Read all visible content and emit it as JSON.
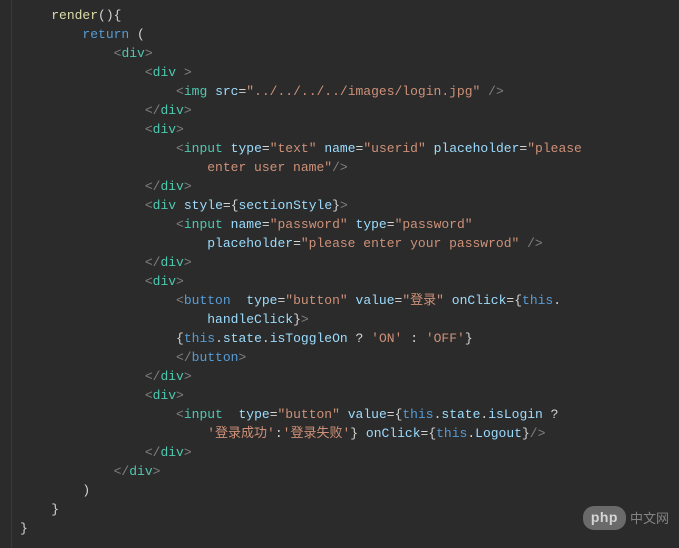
{
  "code": {
    "lines": [
      {
        "indent": 1,
        "segs": [
          {
            "cls": "fn",
            "t": "render"
          },
          {
            "cls": "punct",
            "t": "(){"
          }
        ]
      },
      {
        "indent": 2,
        "segs": [
          {
            "cls": "kw",
            "t": "return"
          },
          {
            "cls": "plain",
            "t": " ("
          }
        ]
      },
      {
        "indent": 3,
        "segs": [
          {
            "cls": "tag",
            "t": "<"
          },
          {
            "cls": "tagname",
            "t": "div"
          },
          {
            "cls": "tag",
            "t": ">"
          }
        ]
      },
      {
        "indent": 4,
        "segs": [
          {
            "cls": "tag",
            "t": "<"
          },
          {
            "cls": "tagname",
            "t": "div"
          },
          {
            "cls": "plain",
            "t": " "
          },
          {
            "cls": "tag",
            "t": ">"
          }
        ]
      },
      {
        "indent": 5,
        "segs": [
          {
            "cls": "tag",
            "t": "<"
          },
          {
            "cls": "tagname",
            "t": "img"
          },
          {
            "cls": "plain",
            "t": " "
          },
          {
            "cls": "attr",
            "t": "src"
          },
          {
            "cls": "eq",
            "t": "="
          },
          {
            "cls": "str",
            "t": "\"../../../../images/login.jpg\""
          },
          {
            "cls": "plain",
            "t": " "
          },
          {
            "cls": "tag",
            "t": "/>"
          }
        ]
      },
      {
        "indent": 4,
        "segs": [
          {
            "cls": "tag",
            "t": "</"
          },
          {
            "cls": "tagname",
            "t": "div"
          },
          {
            "cls": "tag",
            "t": ">"
          }
        ]
      },
      {
        "indent": 4,
        "segs": [
          {
            "cls": "tag",
            "t": "<"
          },
          {
            "cls": "tagname",
            "t": "div"
          },
          {
            "cls": "tag",
            "t": ">"
          }
        ]
      },
      {
        "indent": 5,
        "segs": [
          {
            "cls": "tag",
            "t": "<"
          },
          {
            "cls": "tagname",
            "t": "input"
          },
          {
            "cls": "plain",
            "t": " "
          },
          {
            "cls": "attr",
            "t": "type"
          },
          {
            "cls": "eq",
            "t": "="
          },
          {
            "cls": "str",
            "t": "\"text\""
          },
          {
            "cls": "plain",
            "t": " "
          },
          {
            "cls": "attr",
            "t": "name"
          },
          {
            "cls": "eq",
            "t": "="
          },
          {
            "cls": "str",
            "t": "\"userid\""
          },
          {
            "cls": "plain",
            "t": " "
          },
          {
            "cls": "attr",
            "t": "placeholder"
          },
          {
            "cls": "eq",
            "t": "="
          },
          {
            "cls": "str",
            "t": "\"please "
          }
        ]
      },
      {
        "indent": 6,
        "segs": [
          {
            "cls": "str",
            "t": "enter user name\""
          },
          {
            "cls": "tag",
            "t": "/>"
          }
        ]
      },
      {
        "indent": 4,
        "segs": [
          {
            "cls": "tag",
            "t": "</"
          },
          {
            "cls": "tagname",
            "t": "div"
          },
          {
            "cls": "tag",
            "t": ">"
          }
        ]
      },
      {
        "indent": 4,
        "segs": [
          {
            "cls": "tag",
            "t": "<"
          },
          {
            "cls": "tagname",
            "t": "div"
          },
          {
            "cls": "plain",
            "t": " "
          },
          {
            "cls": "attr",
            "t": "style"
          },
          {
            "cls": "eq",
            "t": "="
          },
          {
            "cls": "brace",
            "t": "{"
          },
          {
            "cls": "var",
            "t": "sectionStyle"
          },
          {
            "cls": "brace",
            "t": "}"
          },
          {
            "cls": "tag",
            "t": ">"
          }
        ]
      },
      {
        "indent": 5,
        "segs": [
          {
            "cls": "tag",
            "t": "<"
          },
          {
            "cls": "tagname",
            "t": "input"
          },
          {
            "cls": "plain",
            "t": " "
          },
          {
            "cls": "attr",
            "t": "name"
          },
          {
            "cls": "eq",
            "t": "="
          },
          {
            "cls": "str",
            "t": "\"password\""
          },
          {
            "cls": "plain",
            "t": " "
          },
          {
            "cls": "attr",
            "t": "type"
          },
          {
            "cls": "eq",
            "t": "="
          },
          {
            "cls": "str",
            "t": "\"password\""
          },
          {
            "cls": "plain",
            "t": " "
          }
        ]
      },
      {
        "indent": 6,
        "segs": [
          {
            "cls": "attr",
            "t": "placeholder"
          },
          {
            "cls": "eq",
            "t": "="
          },
          {
            "cls": "str",
            "t": "\"please enter your passwrod\""
          },
          {
            "cls": "plain",
            "t": " "
          },
          {
            "cls": "tag",
            "t": "/>"
          }
        ]
      },
      {
        "indent": 4,
        "segs": [
          {
            "cls": "tag",
            "t": "</"
          },
          {
            "cls": "tagname",
            "t": "div"
          },
          {
            "cls": "tag",
            "t": ">"
          }
        ]
      },
      {
        "indent": 4,
        "segs": [
          {
            "cls": "tag",
            "t": "<"
          },
          {
            "cls": "tagname",
            "t": "div"
          },
          {
            "cls": "tag",
            "t": ">"
          }
        ]
      },
      {
        "indent": 5,
        "segs": [
          {
            "cls": "tag",
            "t": "<"
          },
          {
            "cls": "tagname-alt",
            "t": "button"
          },
          {
            "cls": "plain",
            "t": "  "
          },
          {
            "cls": "attr",
            "t": "type"
          },
          {
            "cls": "eq",
            "t": "="
          },
          {
            "cls": "str",
            "t": "\"button\""
          },
          {
            "cls": "plain",
            "t": " "
          },
          {
            "cls": "attr",
            "t": "value"
          },
          {
            "cls": "eq",
            "t": "="
          },
          {
            "cls": "str",
            "t": "\"登录\""
          },
          {
            "cls": "plain",
            "t": " "
          },
          {
            "cls": "attr",
            "t": "onClick"
          },
          {
            "cls": "eq",
            "t": "="
          },
          {
            "cls": "brace",
            "t": "{"
          },
          {
            "cls": "kw",
            "t": "this"
          },
          {
            "cls": "punct",
            "t": "."
          }
        ]
      },
      {
        "indent": 6,
        "segs": [
          {
            "cls": "var",
            "t": "handleClick"
          },
          {
            "cls": "brace",
            "t": "}"
          },
          {
            "cls": "tag",
            "t": ">"
          }
        ]
      },
      {
        "indent": 5,
        "segs": [
          {
            "cls": "brace",
            "t": "{"
          },
          {
            "cls": "kw",
            "t": "this"
          },
          {
            "cls": "punct",
            "t": "."
          },
          {
            "cls": "var",
            "t": "state"
          },
          {
            "cls": "punct",
            "t": "."
          },
          {
            "cls": "var",
            "t": "isToggleOn"
          },
          {
            "cls": "plain",
            "t": " "
          },
          {
            "cls": "op",
            "t": "?"
          },
          {
            "cls": "plain",
            "t": " "
          },
          {
            "cls": "str",
            "t": "'ON'"
          },
          {
            "cls": "plain",
            "t": " "
          },
          {
            "cls": "op",
            "t": ":"
          },
          {
            "cls": "plain",
            "t": " "
          },
          {
            "cls": "str",
            "t": "'OFF'"
          },
          {
            "cls": "brace",
            "t": "}"
          }
        ]
      },
      {
        "indent": 5,
        "segs": [
          {
            "cls": "tag",
            "t": "</"
          },
          {
            "cls": "tagname-alt",
            "t": "button"
          },
          {
            "cls": "tag",
            "t": ">"
          }
        ]
      },
      {
        "indent": 4,
        "segs": [
          {
            "cls": "tag",
            "t": "</"
          },
          {
            "cls": "tagname",
            "t": "div"
          },
          {
            "cls": "tag",
            "t": ">"
          }
        ]
      },
      {
        "indent": 4,
        "segs": [
          {
            "cls": "tag",
            "t": "<"
          },
          {
            "cls": "tagname",
            "t": "div"
          },
          {
            "cls": "tag",
            "t": ">"
          }
        ]
      },
      {
        "indent": 5,
        "segs": [
          {
            "cls": "tag",
            "t": "<"
          },
          {
            "cls": "tagname",
            "t": "input"
          },
          {
            "cls": "plain",
            "t": "  "
          },
          {
            "cls": "attr",
            "t": "type"
          },
          {
            "cls": "eq",
            "t": "="
          },
          {
            "cls": "str",
            "t": "\"button\""
          },
          {
            "cls": "plain",
            "t": " "
          },
          {
            "cls": "attr",
            "t": "value"
          },
          {
            "cls": "eq",
            "t": "="
          },
          {
            "cls": "brace",
            "t": "{"
          },
          {
            "cls": "kw",
            "t": "this"
          },
          {
            "cls": "punct",
            "t": "."
          },
          {
            "cls": "var",
            "t": "state"
          },
          {
            "cls": "punct",
            "t": "."
          },
          {
            "cls": "var",
            "t": "isLogin"
          },
          {
            "cls": "plain",
            "t": " "
          },
          {
            "cls": "op",
            "t": "?"
          },
          {
            "cls": "plain",
            "t": " "
          }
        ]
      },
      {
        "indent": 6,
        "segs": [
          {
            "cls": "str",
            "t": "'登录成功'"
          },
          {
            "cls": "op",
            "t": ":"
          },
          {
            "cls": "str",
            "t": "'登录失败'"
          },
          {
            "cls": "brace",
            "t": "}"
          },
          {
            "cls": "plain",
            "t": " "
          },
          {
            "cls": "attr",
            "t": "onClick"
          },
          {
            "cls": "eq",
            "t": "="
          },
          {
            "cls": "brace",
            "t": "{"
          },
          {
            "cls": "kw",
            "t": "this"
          },
          {
            "cls": "punct",
            "t": "."
          },
          {
            "cls": "var",
            "t": "Logout"
          },
          {
            "cls": "brace",
            "t": "}"
          },
          {
            "cls": "tag",
            "t": "/>"
          }
        ]
      },
      {
        "indent": 4,
        "segs": [
          {
            "cls": "tag",
            "t": "</"
          },
          {
            "cls": "tagname",
            "t": "div"
          },
          {
            "cls": "tag",
            "t": ">"
          }
        ]
      },
      {
        "indent": 3,
        "segs": [
          {
            "cls": "tag",
            "t": "</"
          },
          {
            "cls": "tagname",
            "t": "div"
          },
          {
            "cls": "tag",
            "t": ">"
          }
        ]
      },
      {
        "indent": 2,
        "segs": [
          {
            "cls": "plain",
            "t": ")"
          }
        ]
      },
      {
        "indent": 1,
        "segs": [
          {
            "cls": "punct",
            "t": "}"
          }
        ]
      },
      {
        "indent": 0,
        "segs": [
          {
            "cls": "punct",
            "t": "}"
          }
        ]
      }
    ],
    "indent_unit": "    "
  },
  "watermark": {
    "pill": "php",
    "suffix": "中文网"
  }
}
